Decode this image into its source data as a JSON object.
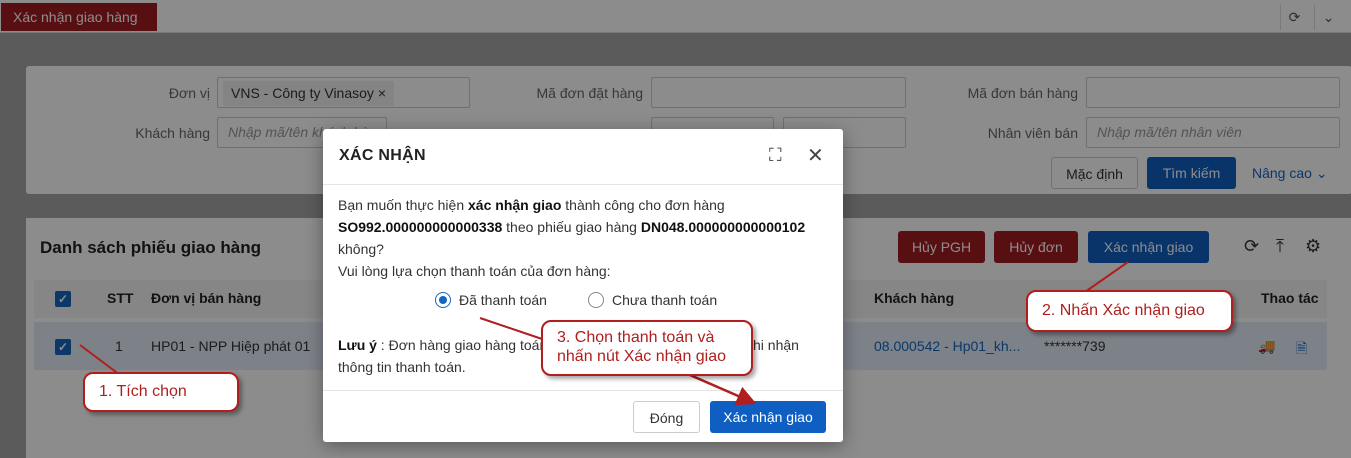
{
  "app": {
    "tab_title": "Xác nhận giao hàng",
    "refresh_icon": "⟳",
    "chevron_icon": "⌄"
  },
  "filters": {
    "don_vi_label": "Đơn vị",
    "don_vi_value": "VNS - Công ty Vinasoy",
    "ma_don_dat_hang_label": "Mã đơn đặt hàng",
    "ma_don_ban_hang_label": "Mã đơn bán hàng",
    "khach_hang_label": "Khách hàng",
    "khach_hang_placeholder": "Nhập mã/tên khách hàng",
    "nhan_vien_ban_label": "Nhân viên bán",
    "nhan_vien_ban_placeholder": "Nhập mã/tên nhân viên",
    "mac_dinh": "Mặc định",
    "tim_kiem": "Tìm kiếm",
    "nang_cao": "Nâng cao"
  },
  "list": {
    "title": "Danh sách phiếu giao hàng",
    "btn_huy_pgh": "Hủy PGH",
    "btn_huy_don": "Hủy đơn",
    "btn_xac_nhan_giao": "Xác nhận giao",
    "columns": {
      "stt": "STT",
      "don_vi_ban_hang": "Đơn vị bán hàng",
      "khach_hang": "Khách hàng",
      "thao_tac": "Thao tác"
    },
    "rows": [
      {
        "stt": "1",
        "don_vi_ban_hang": "HP01 - NPP Hiệp phát 01",
        "khach_hang": "08.000542 - Hp01_kh...",
        "phone": "*******739"
      }
    ]
  },
  "modal": {
    "title": "XÁC NHẬN",
    "line1_pre": "Bạn muốn thực hiện ",
    "line1_bold": "xác nhận giao",
    "line1_post": " thành công cho đơn hàng",
    "order_code": "SO992.000000000000338",
    "line2_mid": " theo phiếu giao hàng ",
    "delivery_code": "DN048.000000000000102",
    "line3": "không?",
    "line4": "Vui lòng lựa chọn thanh toán của đơn hàng:",
    "option_paid": "Đã thanh toán",
    "option_unpaid": "Chưa thanh toán",
    "note_label": "Lưu ý",
    "note_text_a": " : Đơn hàng giao hàng toán",
    "note_text_b": "hi nhận",
    "note_line2": "thông tin thanh toán.",
    "btn_close": "Đóng",
    "btn_confirm": "Xác nhận giao"
  },
  "callouts": {
    "step1": "1. Tích chọn",
    "step2": "2. Nhấn Xác nhận giao",
    "step3_line1": "3. Chọn thanh toán và",
    "step3_line2": "nhấn nút Xác nhận giao"
  },
  "colors": {
    "brand_red": "#a11d21",
    "primary_blue": "#0f5fc2",
    "callout_red": "#b01e1e"
  }
}
